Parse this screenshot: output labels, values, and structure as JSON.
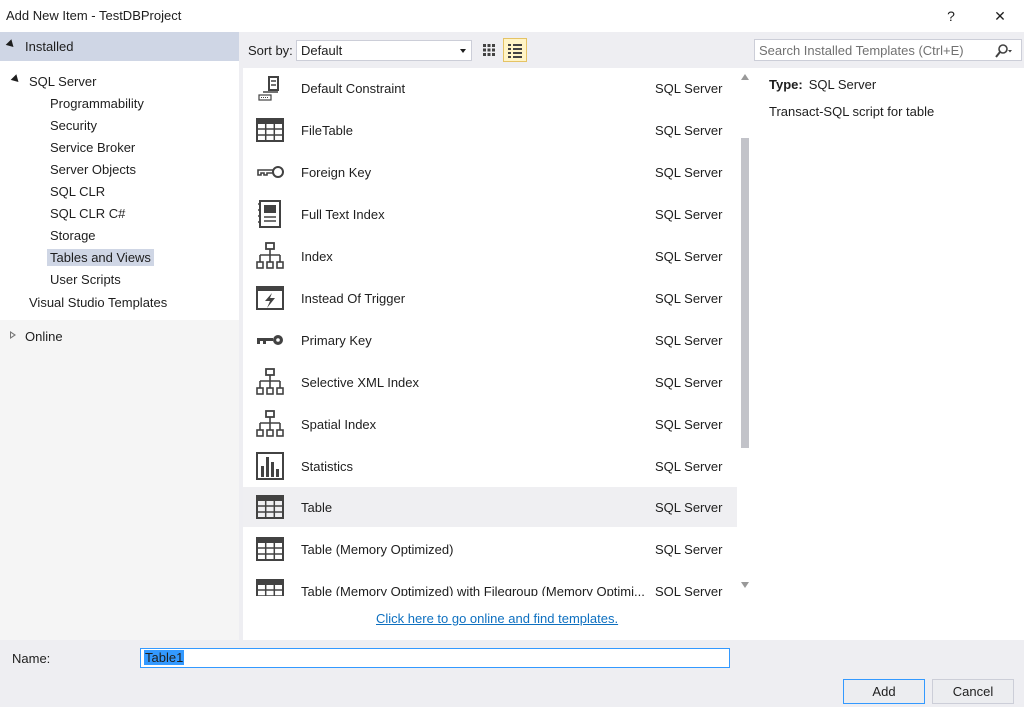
{
  "window": {
    "title": "Add New Item - TestDBProject",
    "help_label": "?",
    "close_label": "✕"
  },
  "left_panel": {
    "installed_label": "Installed",
    "root_label": "SQL Server",
    "children": [
      "Programmability",
      "Security",
      "Service Broker",
      "Server Objects",
      "SQL CLR",
      "SQL CLR C#",
      "Storage",
      "Tables and Views",
      "User Scripts"
    ],
    "selected": "Tables and Views",
    "vs_templates_label": "Visual Studio Templates",
    "online_label": "Online"
  },
  "toolbar": {
    "sort_label": "Sort by:",
    "sort_value": "Default"
  },
  "templates": [
    {
      "name": "Default Constraint",
      "category": "SQL Server",
      "icon": "default-constraint-icon"
    },
    {
      "name": "FileTable",
      "category": "SQL Server",
      "icon": "table-icon"
    },
    {
      "name": "Foreign Key",
      "category": "SQL Server",
      "icon": "key-outline-icon"
    },
    {
      "name": "Full Text Index",
      "category": "SQL Server",
      "icon": "fulltext-index-icon"
    },
    {
      "name": "Index",
      "category": "SQL Server",
      "icon": "hierarchy-icon"
    },
    {
      "name": "Instead Of Trigger",
      "category": "SQL Server",
      "icon": "trigger-icon"
    },
    {
      "name": "Primary Key",
      "category": "SQL Server",
      "icon": "key-icon"
    },
    {
      "name": "Selective XML Index",
      "category": "SQL Server",
      "icon": "hierarchy-icon"
    },
    {
      "name": "Spatial Index",
      "category": "SQL Server",
      "icon": "hierarchy-icon"
    },
    {
      "name": "Statistics",
      "category": "SQL Server",
      "icon": "statistics-icon"
    },
    {
      "name": "Table",
      "category": "SQL Server",
      "icon": "table-icon"
    },
    {
      "name": "Table (Memory Optimized)",
      "category": "SQL Server",
      "icon": "table-icon"
    },
    {
      "name": "Table (Memory Optimized) with Filegroup (Memory Optimi...",
      "category": "SQL Server",
      "icon": "table-icon"
    }
  ],
  "selected_template": "Table",
  "online_link": "Click here to go online and find templates.",
  "search": {
    "placeholder": "Search Installed Templates (Ctrl+E)"
  },
  "details": {
    "type_label": "Type:",
    "type_value": "SQL Server",
    "description": "Transact-SQL script for table"
  },
  "name_row": {
    "label": "Name:",
    "value": "Table1"
  },
  "buttons": {
    "add": "Add",
    "cancel": "Cancel"
  },
  "colors": {
    "accent": "#3399ff",
    "link": "#0e70c0",
    "selection": "#cfd6e5"
  }
}
